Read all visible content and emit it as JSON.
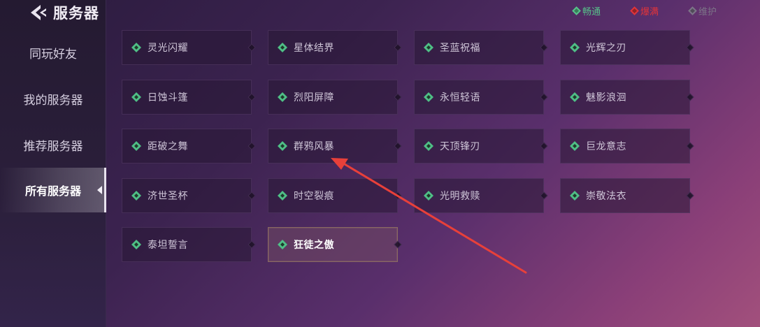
{
  "header": {
    "title": "服务器"
  },
  "sidebar": {
    "items": [
      {
        "label": "同玩好友"
      },
      {
        "label": "我的服务器"
      },
      {
        "label": "推荐服务器"
      },
      {
        "label": "所有服务器"
      }
    ],
    "active_index": 3
  },
  "legend": [
    {
      "label": "畅通",
      "color": "#57c28a"
    },
    {
      "label": "爆满",
      "color": "#e0343a"
    },
    {
      "label": "维护",
      "color": "#7c7488"
    }
  ],
  "status_color": "#4fbf86",
  "servers": [
    {
      "label": "灵光闪耀"
    },
    {
      "label": "星体结界"
    },
    {
      "label": "圣蓝祝福"
    },
    {
      "label": "光辉之刃"
    },
    {
      "label": "日蚀斗篷"
    },
    {
      "label": "烈阳屏障"
    },
    {
      "label": "永恒轻语"
    },
    {
      "label": "魅影浪洄"
    },
    {
      "label": "距破之舞"
    },
    {
      "label": "群鸦风暴"
    },
    {
      "label": "天顶锋刃"
    },
    {
      "label": "巨龙意志"
    },
    {
      "label": "济世圣杯"
    },
    {
      "label": "时空裂痕"
    },
    {
      "label": "光明救赎"
    },
    {
      "label": "崇敬法衣"
    },
    {
      "label": "泰坦誓言"
    },
    {
      "label": "狂徒之傲"
    }
  ],
  "selected_server_index": 17,
  "annotation_color": "#e8403a"
}
